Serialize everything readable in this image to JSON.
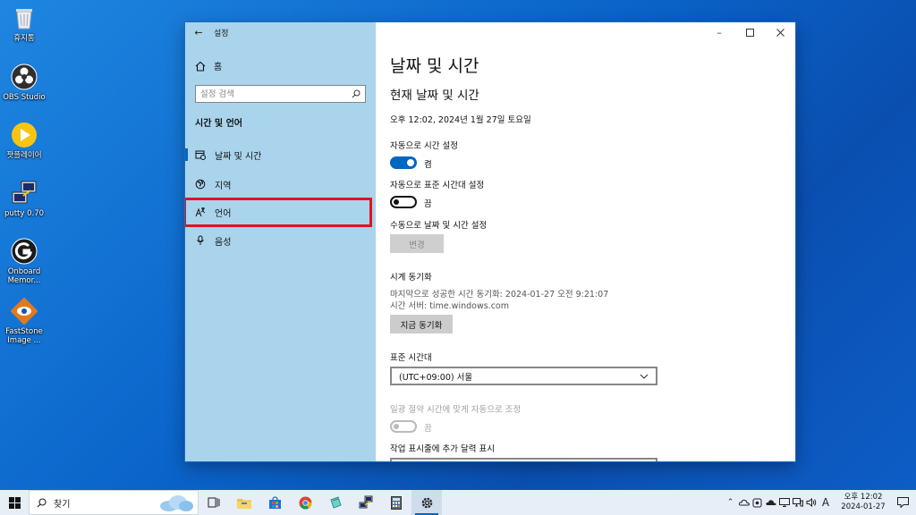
{
  "desktop": {
    "icons": [
      {
        "label": "휴지통",
        "icon": "recycle-bin-icon"
      },
      {
        "label": "OBS Studio",
        "icon": "obs-icon"
      },
      {
        "label": "팟플레이어",
        "icon": "potplayer-icon"
      },
      {
        "label": "putty 0.70",
        "icon": "putty-icon"
      },
      {
        "label": "Onboard Memor...",
        "icon": "onboard-memory-icon"
      },
      {
        "label": "FastStone Image ...",
        "icon": "faststone-icon"
      }
    ]
  },
  "window": {
    "title": "설정",
    "sidebar": {
      "home_label": "홈",
      "search_placeholder": "설정 검색",
      "section_title": "시간 및 언어",
      "items": [
        {
          "label": "날짜 및 시간",
          "icon": "calendar-clock-icon"
        },
        {
          "label": "지역",
          "icon": "globe-icon"
        },
        {
          "label": "언어",
          "icon": "language-icon"
        },
        {
          "label": "음성",
          "icon": "microphone-icon"
        }
      ]
    },
    "content": {
      "page_title": "날짜 및 시간",
      "section_heading": "현재 날짜 및 시간",
      "current_datetime": "오후 12:02, 2024년 1월 27일 토요일",
      "auto_time_label": "자동으로 시간 설정",
      "auto_time_state": "켬",
      "auto_timezone_label": "자동으로 표준 시간대 설정",
      "auto_timezone_state": "끔",
      "manual_label": "수동으로 날짜 및 시간 설정",
      "change_button": "변경",
      "sync_heading": "시계 동기화",
      "sync_last": "마지막으로 성공한 시간 동기화: 2024-01-27 오전 9:21:07",
      "sync_server": "시간 서버: time.windows.com",
      "sync_button": "지금 동기화",
      "timezone_heading": "표준 시간대",
      "timezone_value": "(UTC+09:00) 서울",
      "dst_label": "일광 절약 시간에 맞게 자동으로 조정",
      "dst_state": "끔",
      "taskbar_calendar_label": "작업 표시줄에 추가 달력 표시"
    }
  },
  "taskbar": {
    "search_label": "찾기",
    "tray_ime": "A",
    "clock_time": "오후 12:02",
    "clock_date": "2024-01-27"
  },
  "colors": {
    "accent": "#0067c0",
    "sidebar_bg": "#a9d4ec",
    "highlight": "#e0141e"
  }
}
